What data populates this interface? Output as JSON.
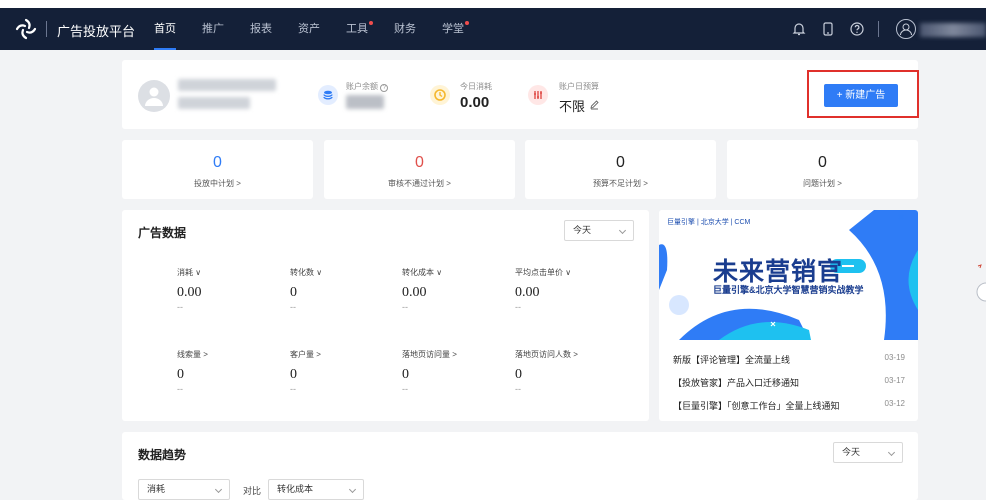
{
  "nav": {
    "brand": "广告投放平台",
    "menu": [
      {
        "label": "首页",
        "active": true,
        "dot": false
      },
      {
        "label": "推广",
        "active": false,
        "dot": false
      },
      {
        "label": "报表",
        "active": false,
        "dot": false
      },
      {
        "label": "资产",
        "active": false,
        "dot": false
      },
      {
        "label": "工具",
        "active": false,
        "dot": true
      },
      {
        "label": "财务",
        "active": false,
        "dot": false
      },
      {
        "label": "学堂",
        "active": false,
        "dot": true
      }
    ],
    "icons": [
      "bell-icon",
      "mobile-icon",
      "help-icon",
      "user-icon"
    ]
  },
  "account": {
    "balance_label": "账户余额",
    "today_label": "今日消耗",
    "today_value": "0.00",
    "budget_label": "账户日预算",
    "budget_value": "不限",
    "new_ad_button": "+ 新建广告"
  },
  "kpis": [
    {
      "value": "0",
      "label": "投放中计划 >",
      "color": "blue"
    },
    {
      "value": "0",
      "label": "审核不通过计划 >",
      "color": "red"
    },
    {
      "value": "0",
      "label": "预算不足计划 >",
      "color": "black"
    },
    {
      "value": "0",
      "label": "问题计划 >",
      "color": "black"
    }
  ],
  "ad_data": {
    "title": "广告数据",
    "range": "今天",
    "metrics": [
      {
        "label": "消耗 ∨",
        "value": "0.00",
        "delta": "--"
      },
      {
        "label": "转化数 ∨",
        "value": "0",
        "delta": "--"
      },
      {
        "label": "转化成本 ∨",
        "value": "0.00",
        "delta": "--"
      },
      {
        "label": "平均点击单价 ∨",
        "value": "0.00",
        "delta": "--"
      },
      {
        "label": "线索量 >",
        "value": "0",
        "delta": "--"
      },
      {
        "label": "客户量 >",
        "value": "0",
        "delta": "--"
      },
      {
        "label": "落地页访问量 >",
        "value": "0",
        "delta": "--"
      },
      {
        "label": "落地页访问人数 >",
        "value": "0",
        "delta": "--"
      }
    ]
  },
  "banner": {
    "sponsors": "巨量引擎 | 北京大学 | CCM",
    "title": "未来营销官",
    "subtitle": "巨量引擎&北京大学智慧营销实战教学"
  },
  "news": [
    {
      "title": "新版【评论管理】全流量上线",
      "date": "03-19"
    },
    {
      "title": "【投放管家】产品入口迁移通知",
      "date": "03-17"
    },
    {
      "title": "【巨量引擎】「创意工作台」全量上线通知",
      "date": "03-12"
    }
  ],
  "trend": {
    "title": "数据趋势",
    "range": "今天",
    "metric_a": "消耗",
    "compare_label": "对比",
    "metric_b": "转化成本"
  },
  "colors": {
    "nav_bg": "#142038",
    "accent": "#2f7cf6",
    "danger": "#e0302b"
  }
}
